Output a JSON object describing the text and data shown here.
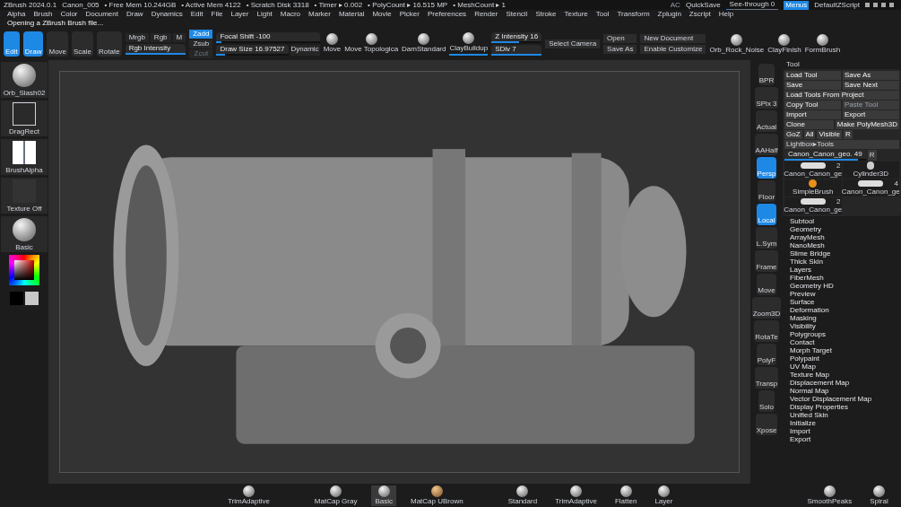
{
  "title_bar": {
    "app": "ZBrush 2024.0.1",
    "file": "Canon_005",
    "stats": [
      "• Free Mem 10.244GB",
      "• Active Mem 4122",
      "• Scratch Disk 3318",
      "• Timer ▸ 0.002",
      "• PolyCount ▸ 16.515 MP",
      "• MeshCount ▸ 1"
    ],
    "ac": "AC",
    "quicksave": "QuickSave",
    "see_through": {
      "label": "See-through 0",
      "level": 0.05
    },
    "menus": {
      "label": "Menus",
      "selected": true
    },
    "default_script": "DefaultZScript"
  },
  "menu_bar": [
    "Alpha",
    "Brush",
    "Color",
    "Document",
    "Draw",
    "Dynamics",
    "Edit",
    "File",
    "Layer",
    "Light",
    "Macro",
    "Marker",
    "Material",
    "Movie",
    "Picker",
    "Preferences",
    "Render",
    "Stencil",
    "Stroke",
    "Texture",
    "Tool",
    "Transform",
    "Zplugin",
    "Zscript",
    "Help"
  ],
  "status": "Opening a ZBrush Brush file...",
  "top_shelf": {
    "modes": [
      {
        "label": "Edit",
        "selected": true
      },
      {
        "label": "Draw",
        "selected": true
      },
      {
        "label": "Move",
        "selected": false
      },
      {
        "label": "Scale",
        "selected": false
      },
      {
        "label": "Rotate",
        "selected": false
      }
    ],
    "channels": [
      {
        "label": "Mrgb",
        "selected": false
      },
      {
        "label": "Rgb",
        "selected": false
      },
      {
        "label": "M",
        "selected": false
      }
    ],
    "rgb_intensity": {
      "label": "Rgb Intensity",
      "level": 1
    },
    "z_modes": [
      {
        "label": "Zadd",
        "selected": true,
        "disabled": false
      },
      {
        "label": "Zsub",
        "selected": false,
        "disabled": false
      },
      {
        "label": "Zcut",
        "selected": false,
        "disabled": true
      }
    ],
    "focal_shift": {
      "label": "Focal Shift -100",
      "level": 0.05
    },
    "draw_size": {
      "label": "Draw Size 16.97527",
      "level": 0.12
    },
    "dynamic": "Dynamic",
    "brushes": [
      {
        "label": "Move",
        "selected": false
      },
      {
        "label": "Move Topologica",
        "selected": false
      },
      {
        "label": "DamStandard",
        "selected": false
      },
      {
        "label": "ClayBuildup",
        "selected": true
      }
    ],
    "z_intensity": {
      "label": "Z Intensity 16",
      "level": 0.55
    },
    "sdiv": {
      "label": "SDiv 7",
      "level": 1
    },
    "select_camera": "Select Camera",
    "file_buttons": [
      "Open",
      "Save As"
    ],
    "doc_buttons": [
      "New Document",
      "Enable Customize"
    ],
    "brushes2": [
      "Orb_Rock_Noise",
      "ClayFinish",
      "FormBrush"
    ]
  },
  "left_shelf": [
    {
      "kind": "brush",
      "label": "Orb_Slash02"
    },
    {
      "kind": "stroke",
      "label": "DragRect"
    },
    {
      "kind": "alpha",
      "label": "BrushAlpha"
    },
    {
      "kind": "texture",
      "label": "Texture Off"
    },
    {
      "kind": "material",
      "label": "Basic"
    }
  ],
  "right_shelf": [
    {
      "label": "BPR",
      "selected": false
    },
    {
      "label": "SPix 3",
      "selected": false
    },
    {
      "label": "Actual",
      "selected": false
    },
    {
      "label": "AAHalf",
      "selected": false
    },
    {
      "label": "Persp",
      "selected": true
    },
    {
      "label": "Floor",
      "selected": false
    },
    {
      "label": "Local",
      "selected": true
    },
    {
      "label": "L.Sym",
      "selected": false
    },
    {
      "label": "Frame",
      "selected": false
    },
    {
      "label": "Move",
      "selected": false
    },
    {
      "label": "Zoom3D",
      "selected": false
    },
    {
      "label": "RotaTe",
      "selected": false
    },
    {
      "label": "PolyF",
      "selected": false
    },
    {
      "label": "Transp",
      "selected": false
    },
    {
      "label": "Solo",
      "selected": false
    },
    {
      "label": "Xpose",
      "selected": false
    }
  ],
  "tool_panel": {
    "title": "Tool",
    "buttons": [
      {
        "label": "Load Tool",
        "disabled": false
      },
      {
        "label": "Save As",
        "disabled": false
      },
      {
        "label": "Save",
        "disabled": false
      },
      {
        "label": "Save Next",
        "disabled": false
      },
      {
        "label": "Load Tools From Project",
        "disabled": false
      },
      {
        "label": "Copy Tool",
        "disabled": false
      },
      {
        "label": "Paste Tool",
        "disabled": true
      },
      {
        "label": "Import",
        "disabled": false
      },
      {
        "label": "Export",
        "disabled": false
      },
      {
        "label": "Clone",
        "disabled": false
      },
      {
        "label": "Make PolyMesh3D",
        "disabled": false
      },
      {
        "label": "GoZ",
        "disabled": false
      },
      {
        "label": "All",
        "disabled": false
      },
      {
        "label": "Visible",
        "disabled": false
      },
      {
        "label": "R",
        "disabled": false
      }
    ],
    "lightbox": "Lightbox▸Tools",
    "current_tool": {
      "label": "Canon_Canon_geo. 49",
      "level": 0.9
    },
    "r": "R",
    "thumbnails": [
      {
        "kind": "mesh",
        "label": "Canon_Canon_ge",
        "count": "2"
      },
      {
        "kind": "cylinder",
        "label": "Cylinder3D"
      },
      {
        "kind": "brush",
        "label": "SimpleBrush"
      },
      {
        "kind": "mesh",
        "label": "Canon_Canon_ge",
        "count": "4"
      },
      {
        "kind": "mesh",
        "label": "Canon_Canon_ge",
        "count": "2"
      }
    ],
    "subpalettes": [
      "Subtool",
      "Geometry",
      "ArrayMesh",
      "NanoMesh",
      "Slime Bridge",
      "Thick Skin",
      "Layers",
      "FiberMesh",
      "Geometry HD",
      "Preview",
      "Surface",
      "Deformation",
      "Masking",
      "Visibility",
      "Polygroups",
      "Contact",
      "Morph Target",
      "Polypaint",
      "UV Map",
      "Texture Map",
      "Displacement Map",
      "Normal Map",
      "Vector Displacement Map",
      "Display Properties",
      "Unified Skin",
      "Initialize",
      "Import",
      "Export"
    ]
  },
  "bottom_shelf": [
    {
      "kind": "brush",
      "label": "TrimAdaptive",
      "selected": false
    },
    {
      "kind": "material",
      "label": "MatCap Gray",
      "selected": false
    },
    {
      "kind": "material",
      "label": "Basic",
      "selected": true
    },
    {
      "kind": "bronze",
      "label": "MatCap UBrown",
      "selected": false
    },
    {
      "kind": "brush",
      "label": "Standard",
      "selected": false
    },
    {
      "kind": "brush",
      "label": "TrimAdaptive",
      "selected": false
    },
    {
      "kind": "brush",
      "label": "Flatten",
      "selected": false
    },
    {
      "kind": "brush",
      "label": "Layer",
      "selected": false
    },
    {
      "kind": "brush",
      "label": "SmoothPeaks",
      "selected": false
    },
    {
      "kind": "brush",
      "label": "Spiral",
      "selected": false
    }
  ]
}
